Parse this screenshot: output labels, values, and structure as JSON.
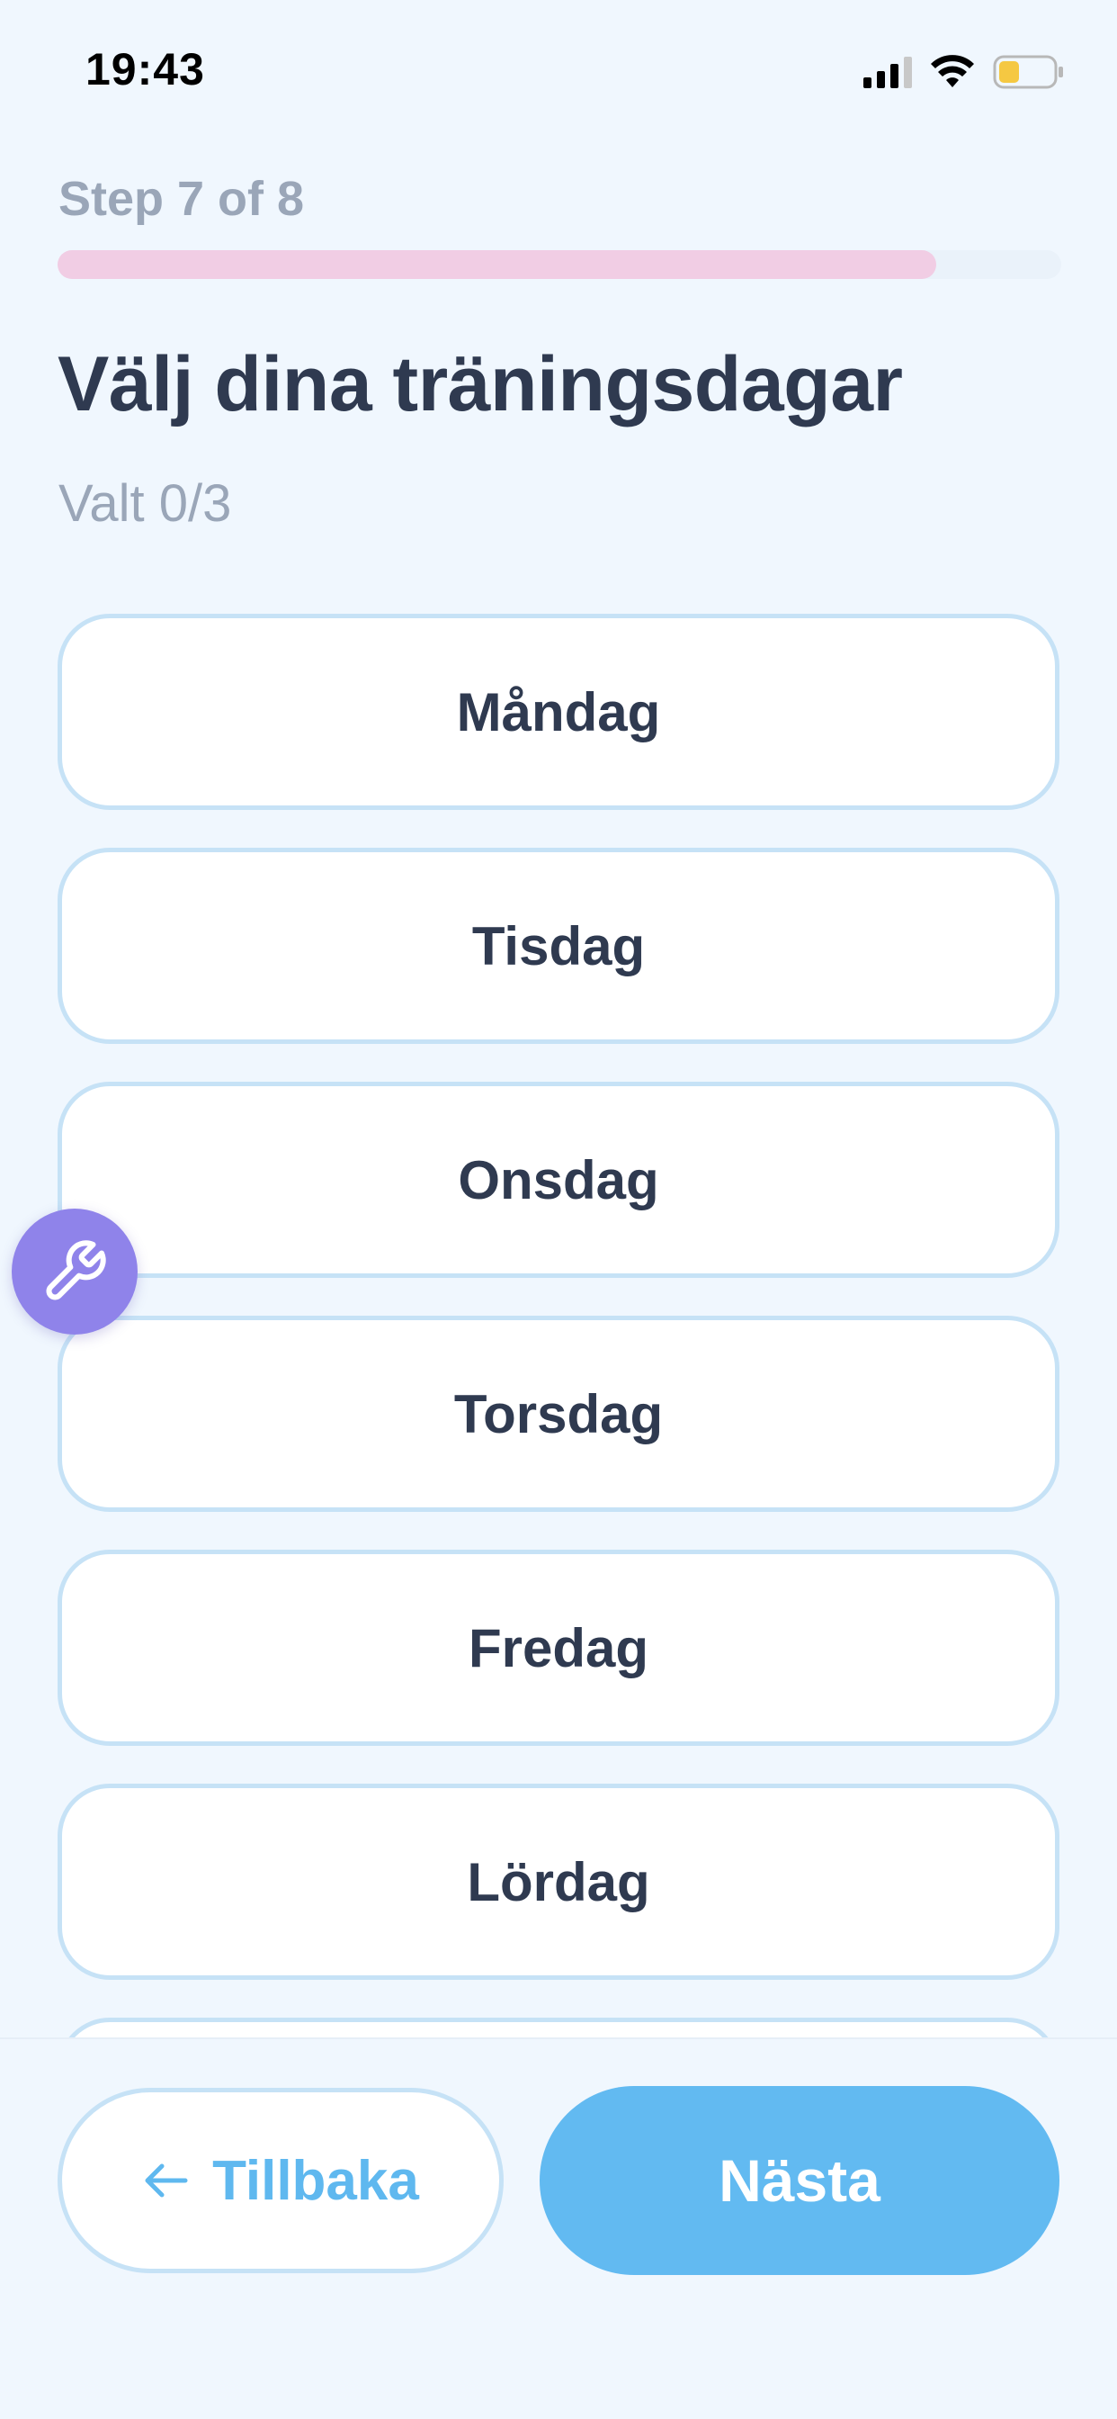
{
  "status_bar": {
    "time": "19:43",
    "icons": [
      "cellular-signal-icon",
      "wifi-icon",
      "battery-icon"
    ],
    "battery_color": "#f5c842"
  },
  "progress": {
    "step_label": "Step 7 of 8",
    "fraction": 0.875,
    "fill_color": "#f1cde4"
  },
  "header": {
    "title": "Välj dina träningsdagar",
    "selected_count": "Valt 0/3"
  },
  "days": [
    {
      "label": "Måndag"
    },
    {
      "label": "Tisdag"
    },
    {
      "label": "Onsdag"
    },
    {
      "label": "Torsdag"
    },
    {
      "label": "Fredag"
    },
    {
      "label": "Lördag"
    },
    {
      "label": ""
    }
  ],
  "tool_button": {
    "icon": "wrench-icon",
    "color": "#8f83ea"
  },
  "footer": {
    "back_label": "Tillbaka",
    "back_icon": "arrow-left-icon",
    "next_label": "Nästa",
    "accent_color": "#62baf1"
  }
}
